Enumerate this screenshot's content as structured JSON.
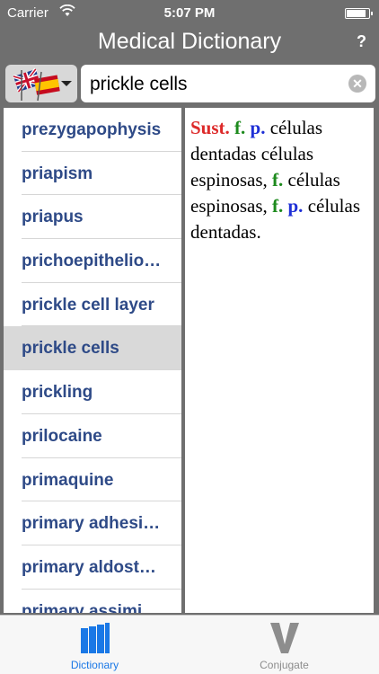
{
  "status": {
    "carrier": "Carrier",
    "time": "5:07 PM",
    "battery_level": 0.9
  },
  "nav": {
    "title": "Medical Dictionary",
    "help_label": "?"
  },
  "search": {
    "value": "prickle cells",
    "language_icon": "uk-spain-flags-icon"
  },
  "list": {
    "items": [
      {
        "label": "prezygapophysis"
      },
      {
        "label": "priapism"
      },
      {
        "label": "priapus"
      },
      {
        "label": "prichoepithelio…"
      },
      {
        "label": "prickle cell layer"
      },
      {
        "label": "prickle cells",
        "selected": true
      },
      {
        "label": "prickling"
      },
      {
        "label": "prilocaine"
      },
      {
        "label": "primaquine"
      },
      {
        "label": "primary adhesi…"
      },
      {
        "label": "primary aldost…"
      },
      {
        "label": "primary assimi"
      }
    ]
  },
  "definition": {
    "sust": "Sust.",
    "f1": "f.",
    "p1": "p.",
    "t1": " células dentadas células espinosas, ",
    "f2": "f.",
    "t2": " células espinosas, ",
    "f3": "f.",
    "p3": "p.",
    "t3": " células dentadas."
  },
  "tabs": [
    {
      "label": "Dictionary",
      "icon": "books-icon",
      "active": true
    },
    {
      "label": "Conjugate",
      "icon": "v-letter-icon",
      "active": false
    }
  ],
  "colors": {
    "header": "#6f6f6f",
    "list_text": "#2e4a87",
    "selected_row": "#d9d9d9",
    "abbr_red": "#dd2a2a",
    "abbr_green": "#1d8a1d",
    "abbr_blue": "#1e2fd6",
    "tab_active": "#1a78e6"
  }
}
